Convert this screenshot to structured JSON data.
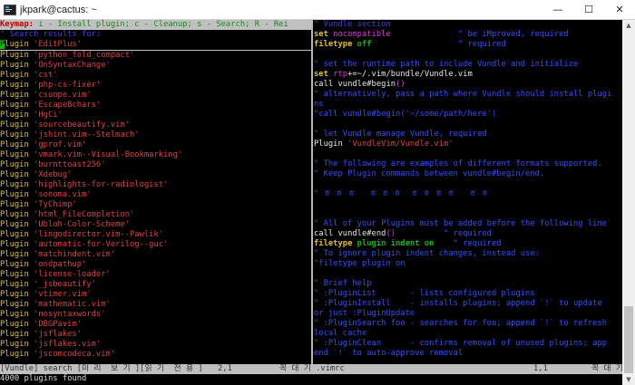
{
  "window": {
    "title": "jkpark@cactus: ~",
    "min_icon": "minimize-icon",
    "max_icon": "maximize-icon",
    "close_icon": "close-icon",
    "min_glyph": "—",
    "max_glyph": "☐",
    "close_glyph": "✕"
  },
  "left_pane": {
    "keymap_label": "Keymap:",
    "keymap_text": " i - Install plugin; c - Cleanup; s - Search; R - Rei",
    "header": "\" Search results for: ",
    "cursor_char": "P",
    "first_rest": "lugin 'EditPlus'",
    "plugin_keyword": "Plugin",
    "plugins": [
      "'EditPlus'",
      "'python_fold_compact'",
      "'OnSyntaxChange'",
      "'cst'",
      "'php-cs-fixer'",
      "'csuope.vim'",
      "'EscapeBchars'",
      "'HgCi'",
      "'sourcebeautify.vim'",
      "'jshint.vim--Stelmach'",
      "'gprof.vim'",
      "'vmark.vim--Visual-Bookmarking'",
      "'burnttoast256'",
      "'Xdebug'",
      "'highlights-for-radiologist'",
      "'sonoma.vim'",
      "'TyChimp'",
      "'html_FileCompletion'",
      "'Ubloh-Color-Scheme'",
      "'lingodirector.vim--Pawlik'",
      "'automatic-for-Verilog--guc'",
      "'matchindent.vim'",
      "'ondpathup'",
      "'license-loader'",
      "'_jsbeautify'",
      "'vtimer.vim'",
      "'mathematic.vim'",
      "'nosyntaxwords'",
      "'DBGPavim'",
      "'jsflakes'",
      "'jsflakes.vim'",
      "'jscomcodeca.vim'"
    ]
  },
  "right_pane": {
    "header": "\" Vundle section",
    "lines": [
      [
        {
          "t": "set ",
          "c": "kw"
        },
        {
          "t": "nocompatible",
          "c": "mag"
        },
        {
          "t": "              \" be iMproved, required",
          "c": "cmt"
        }
      ],
      [
        {
          "t": "filetype ",
          "c": "kw"
        },
        {
          "t": "off",
          "c": "grn"
        },
        {
          "t": "                  \" required",
          "c": "cmt"
        }
      ],
      [
        {
          "t": "",
          "c": "wht"
        }
      ],
      [
        {
          "t": "\" set the runtime path to include Vundle and initialize",
          "c": "cmt"
        }
      ],
      [
        {
          "t": "set ",
          "c": "kw"
        },
        {
          "t": "rtp",
          "c": "mag"
        },
        {
          "t": "+=~/.vim/bundle/Vundle.vim",
          "c": "wht"
        }
      ],
      [
        {
          "t": "call vundle#begin",
          "c": "wht"
        },
        {
          "t": "()",
          "c": "mag"
        }
      ],
      [
        {
          "t": "\" alternatively, pass a path where Vundle should install plugi",
          "c": "cmt"
        }
      ],
      [
        {
          "t": "ns",
          "c": "cmt"
        }
      ],
      [
        {
          "t": "\"call vundle#begin('~/some/path/here')",
          "c": "cmt"
        }
      ],
      [
        {
          "t": "",
          "c": "wht"
        }
      ],
      [
        {
          "t": "\" let Vundle manage Vundle, required",
          "c": "cmt"
        }
      ],
      [
        {
          "t": "Plugin ",
          "c": "wht"
        },
        {
          "t": "'VundleVim/Vundle.vim'",
          "c": "q"
        }
      ],
      [
        {
          "t": "",
          "c": "wht"
        }
      ],
      [
        {
          "t": "\" The following are examples of different formats supported.",
          "c": "cmt"
        }
      ],
      [
        {
          "t": "\" Keep Plugin commands between vundle#begin/end.",
          "c": "cmt"
        }
      ],
      [
        {
          "t": "",
          "c": "wht"
        }
      ],
      [
        {
          "t": "\" ㅎ ㅎ ㅎ   ㅎ ㅎ ㅎ  ㅎ ㅎ ㅎ ㅎ   ㅎ ㅎ",
          "c": "cmt"
        }
      ],
      [
        {
          "t": "",
          "c": "wht"
        }
      ],
      [
        {
          "t": "",
          "c": "wht"
        }
      ],
      [
        {
          "t": "\" All of your Plugins must be added before the following line",
          "c": "cmt"
        }
      ],
      [
        {
          "t": "call vundle#end",
          "c": "wht"
        },
        {
          "t": "()",
          "c": "mag"
        },
        {
          "t": "          \" required",
          "c": "cmt"
        }
      ],
      [
        {
          "t": "filetype ",
          "c": "kw"
        },
        {
          "t": "plugin indent on",
          "c": "grn"
        },
        {
          "t": "    \" required",
          "c": "cmt"
        }
      ],
      [
        {
          "t": "\" To ignore plugin indent changes, instead use:",
          "c": "cmt"
        }
      ],
      [
        {
          "t": "\"filetype plugin on",
          "c": "cmt"
        }
      ],
      [
        {
          "t": "",
          "c": "wht"
        }
      ],
      [
        {
          "t": "\" Brief help",
          "c": "cmt"
        }
      ],
      [
        {
          "t": "\" :PluginList       - lists configured plugins",
          "c": "cmt"
        }
      ],
      [
        {
          "t": "\" :PluginInstall    - installs plugins; append `!` to update",
          "c": "cmt"
        }
      ],
      [
        {
          "t": "or just :PluginUpdate",
          "c": "cmt"
        }
      ],
      [
        {
          "t": "\" :PluginSearch foo - searches for foo; append `!` to refresh",
          "c": "cmt"
        }
      ],
      [
        {
          "t": "local cache",
          "c": "cmt"
        }
      ],
      [
        {
          "t": "\" :PluginClean      - confirms removal of unused plugins; app",
          "c": "cmt"
        }
      ],
      [
        {
          "t": "end `!` to auto-approve removal",
          "c": "cmt"
        }
      ]
    ]
  },
  "status": {
    "left_name": "[Vundle] search [미 리  보 기 ][읽 기  전 용 ]",
    "left_pos": "2,1",
    "left_pct": "꼭 대 기",
    "right_name": ".vimrc",
    "right_pos": "1,1",
    "right_pct": "꼭 대 기"
  },
  "message": "4000 plugins found",
  "scrollbar": {
    "up_icon": "scroll-up-arrow-icon",
    "down_icon": "scroll-down-arrow-icon",
    "up_glyph": "▲",
    "down_glyph": "▼"
  },
  "colors": {
    "plugin_keyword": "#e0c020",
    "plugin_name": "#e04040",
    "comment": "#3050ff",
    "status_bar": "#bfbfbf",
    "cursor": "#00c000"
  }
}
